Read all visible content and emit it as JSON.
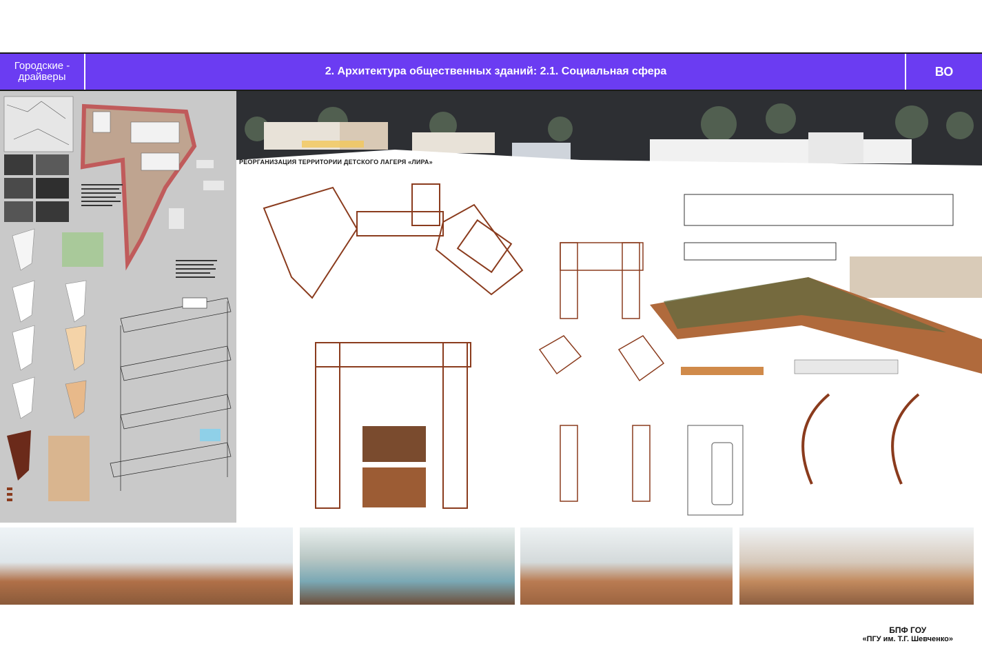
{
  "header": {
    "left_label_line1": "Городские -",
    "left_label_line2": "драйверы",
    "title": "2. Архитектура общественных зданий: 2.1. Социальная сфера",
    "right_label": "ВО"
  },
  "sheet": {
    "project_title": "РЕОРГАНИЗАЦИЯ ТЕРРИТОРИИ ДЕТСКОГО ЛАГЕРЯ «ЛИРА»"
  },
  "footer": {
    "org": "БПФ ГОУ",
    "university": "«ПГУ им. Т.Г. Шевченко»"
  },
  "colors": {
    "header_bg": "#6b3cf2",
    "left_panel_bg": "#c9c9c9",
    "night_bg": "#2d2f33",
    "plan_wall": "#8a3b1d",
    "terrain": "#b06a3c"
  }
}
